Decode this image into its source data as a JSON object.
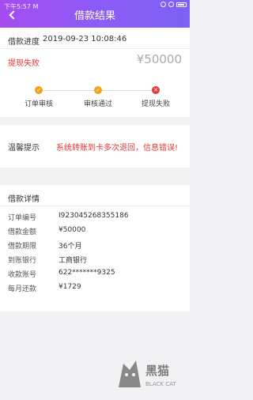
{
  "statusbar": {
    "time": "下午5:57 M"
  },
  "header": {
    "title": "借款结果"
  },
  "progress": {
    "label": "借款进度",
    "datetime": "2019-09-23 10:08:46",
    "status": "提现失败",
    "amount": "¥50000",
    "steps": [
      {
        "label": "订单审核",
        "state": "done"
      },
      {
        "label": "审核通过",
        "state": "done"
      },
      {
        "label": "提现失败",
        "state": "fail"
      }
    ]
  },
  "tip": {
    "label": "温馨提示",
    "text": "系统转账到卡多次退回，信息错误!"
  },
  "detail": {
    "title": "借款详情",
    "rows": [
      {
        "key": "订单编号",
        "value": "I923045268355186"
      },
      {
        "key": "借款金额",
        "value": "¥50000"
      },
      {
        "key": "借款期限",
        "value": "36个月"
      },
      {
        "key": "到账银行",
        "value": "工商银行"
      },
      {
        "key": "收款账号",
        "value": "622*******9325"
      },
      {
        "key": "每月还款",
        "value": "¥1729"
      }
    ]
  },
  "watermark": {
    "text": "黑猫",
    "subtext": "BLACK CAT"
  },
  "colors": {
    "header_start": "#a54cf0",
    "header_end": "#7b61f4",
    "accent_red": "#e53935",
    "step_ok": "#f3a21b"
  }
}
